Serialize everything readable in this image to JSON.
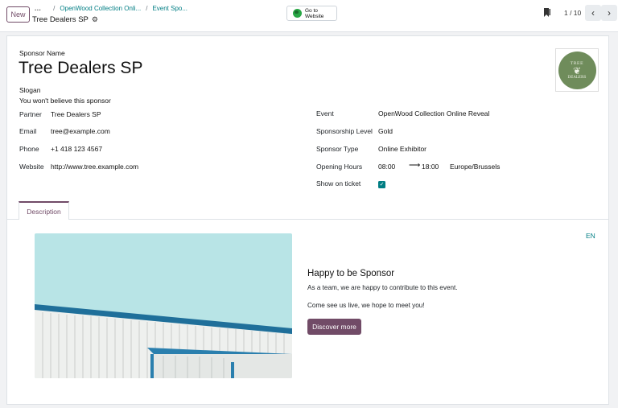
{
  "control_panel": {
    "new_label": "New",
    "breadcrumb_dots": "...",
    "breadcrumb_1": "OpenWood Collection Onli...",
    "breadcrumb_2": "Event Spo...",
    "record_title": "Tree Dealers SP",
    "go_to_website": "Go to Website",
    "pager": "1 / 10"
  },
  "sponsor": {
    "name_label": "Sponsor Name",
    "name": "Tree Dealers SP",
    "slogan_label": "Slogan",
    "slogan": "You won't believe this sponsor",
    "logo_text_top": "TREE",
    "logo_text_bottom": "DEALERS"
  },
  "left_fields": [
    {
      "label": "Partner",
      "value": "Tree Dealers SP"
    },
    {
      "label": "Email",
      "value": "tree@example.com"
    },
    {
      "label": "Phone",
      "value": "+1 418 123 4567"
    },
    {
      "label": "Website",
      "value": "http://www.tree.example.com"
    }
  ],
  "right_fields": {
    "event_label": "Event",
    "event": "OpenWood Collection Online Reveal",
    "level_label": "Sponsorship Level",
    "level": "Gold",
    "type_label": "Sponsor Type",
    "type": "Online Exhibitor",
    "hours_label": "Opening Hours",
    "hours_from": "08:00",
    "hours_to": "18:00",
    "timezone": "Europe/Brussels",
    "show_label": "Show on ticket",
    "show_on_ticket": true
  },
  "tabs": {
    "description": "Description"
  },
  "description": {
    "lang": "EN",
    "title": "Happy to be Sponsor",
    "p1": "As a team, we are happy to contribute to this event.",
    "p2": "Come see us live, we hope to meet you!",
    "button": "Discover more"
  },
  "colors": {
    "brand": "#714b67",
    "accent": "#017e84"
  }
}
